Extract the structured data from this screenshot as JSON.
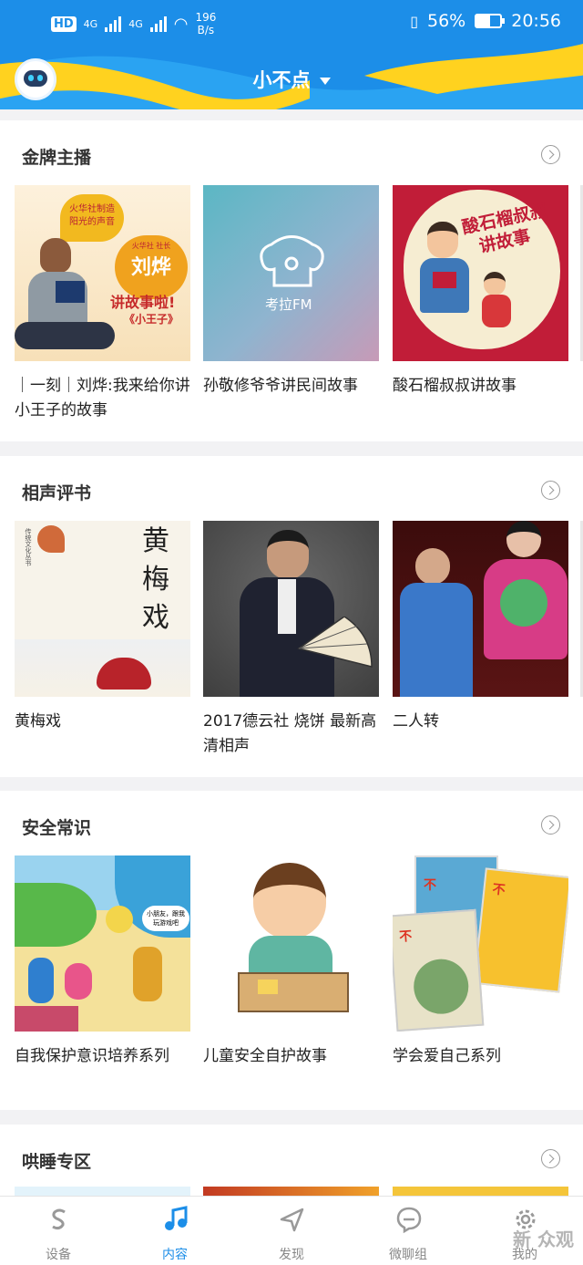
{
  "status_bar": {
    "network_hd": "HD",
    "signal_1": "4G",
    "signal_2": "4G",
    "speed_value": "196",
    "speed_unit": "B/s",
    "battery": "56%",
    "battery_level": 0.56,
    "time": "20:56"
  },
  "header": {
    "title": "小不点",
    "accent_color": "#1c8ee8"
  },
  "sections": [
    {
      "title": "金牌主播",
      "items": [
        {
          "caption": "｜一刻｜刘烨:我来给你讲小王子的故事",
          "art_text": [
            "火华社制造",
            "阳光的声音",
            "火华社 社长",
            "刘烨",
            "讲故事啦!",
            "《小王子》"
          ]
        },
        {
          "caption": "孙敬修爷爷讲民间故事",
          "art_text": [
            "考拉FM"
          ]
        },
        {
          "caption": "酸石榴叔叔讲故事",
          "art_text": [
            "酸石榴叔叔",
            "讲故事"
          ]
        }
      ]
    },
    {
      "title": "相声评书",
      "items": [
        {
          "caption": "黄梅戏",
          "art_text": [
            "黄",
            "梅",
            "戏",
            "传统文化丛书"
          ]
        },
        {
          "caption": "2017德云社 烧饼 最新高清相声",
          "art_text": []
        },
        {
          "caption": "二人转",
          "art_text": []
        }
      ]
    },
    {
      "title": "安全常识",
      "items": [
        {
          "caption": "自我保护意识培养系列",
          "art_text": [
            "小朋友，跟我",
            "玩游戏吧"
          ]
        },
        {
          "caption": "儿童安全自护故事",
          "art_text": []
        },
        {
          "caption": "学会爱自己系列",
          "art_text": [
            "不",
            "不",
            "不"
          ]
        }
      ]
    },
    {
      "title": "哄睡专区",
      "items": []
    }
  ],
  "tabbar": {
    "tabs": [
      {
        "label": "设备",
        "icon": "s-logo-icon",
        "active": false
      },
      {
        "label": "内容",
        "icon": "music-note-icon",
        "active": true
      },
      {
        "label": "发现",
        "icon": "compass-icon",
        "active": false
      },
      {
        "label": "微聊组",
        "icon": "chat-bubble-icon",
        "active": false
      },
      {
        "label": "我的",
        "icon": "gear-icon",
        "active": false
      }
    ]
  },
  "watermark": "新 众观"
}
